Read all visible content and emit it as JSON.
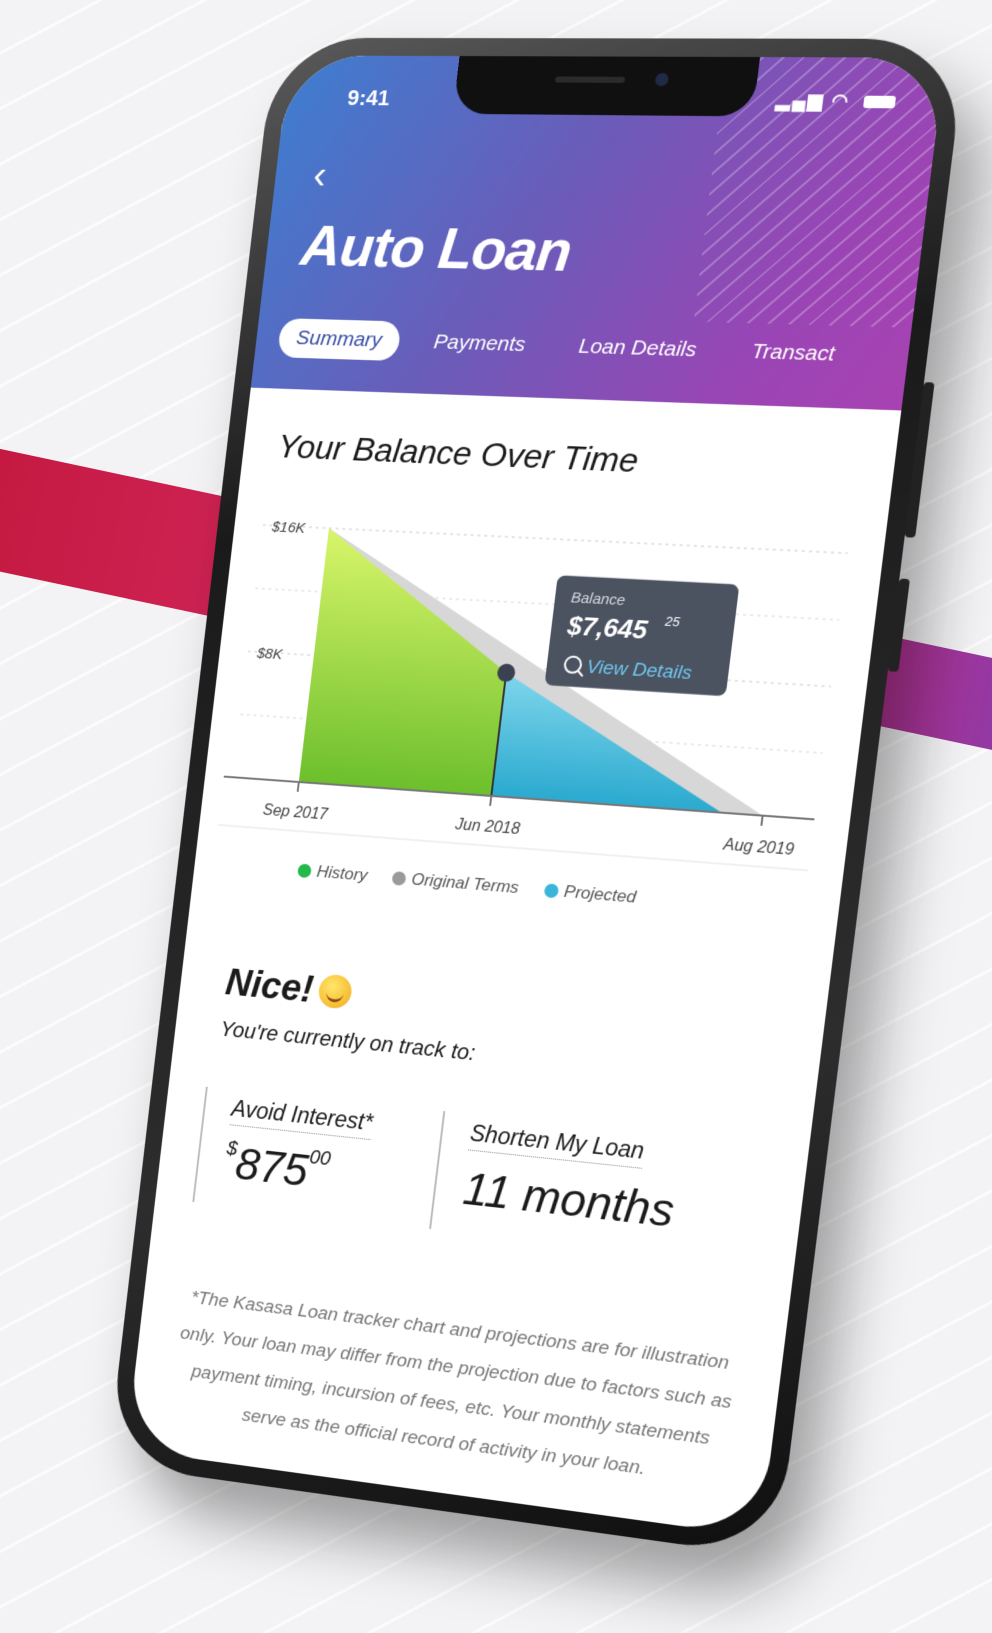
{
  "status_bar": {
    "time": "9:41"
  },
  "header": {
    "title": "Auto Loan",
    "tabs": [
      {
        "label": "Summary",
        "active": true
      },
      {
        "label": "Payments",
        "active": false
      },
      {
        "label": "Loan Details",
        "active": false
      },
      {
        "label": "Transact",
        "active": false
      }
    ]
  },
  "chart_section": {
    "title": "Your Balance Over Time"
  },
  "chart_data": {
    "type": "area",
    "x_ticks": [
      "Sep 2017",
      "Jun 2018",
      "Aug 2019"
    ],
    "y_ticks": [
      "$16K",
      "$8K"
    ],
    "ylim": [
      0,
      16000
    ],
    "series": [
      {
        "name": "History",
        "color": "#6cc23a",
        "x": [
          "Sep 2017",
          "Jun 2018"
        ],
        "values": [
          16000,
          7645.25
        ]
      },
      {
        "name": "Original Terms",
        "color": "#a8a8a8",
        "x": [
          "Sep 2017",
          "Aug 2019"
        ],
        "values": [
          16000,
          0
        ]
      },
      {
        "name": "Projected",
        "color": "#3ab6d8",
        "x": [
          "Jun 2018",
          "Jul 2019"
        ],
        "values": [
          7645.25,
          0
        ]
      }
    ],
    "tooltip": {
      "label": "Balance",
      "value": "$7,645",
      "cents": "25",
      "link": "View Details"
    },
    "legend": [
      "History",
      "Original Terms",
      "Projected"
    ]
  },
  "summary": {
    "headline": "Nice!",
    "subheadline": "You're currently on track to:",
    "stats": [
      {
        "label": "Avoid Interest*",
        "currency": "$",
        "value": "875",
        "cents": "00"
      },
      {
        "label": "Shorten My Loan",
        "value": "11 months"
      }
    ]
  },
  "disclaimer": "*The Kasasa Loan tracker chart and projections are for illustration only. Your loan may differ from the projection due to factors such as payment timing, incursion of fees, etc. Your monthly statements serve as the official record of activity in your loan.",
  "colors": {
    "header_start": "#3d7ed0",
    "header_end": "#a842b2",
    "history": "#6cc23a",
    "projected": "#3ab6d8",
    "original": "#a8a8a8"
  }
}
